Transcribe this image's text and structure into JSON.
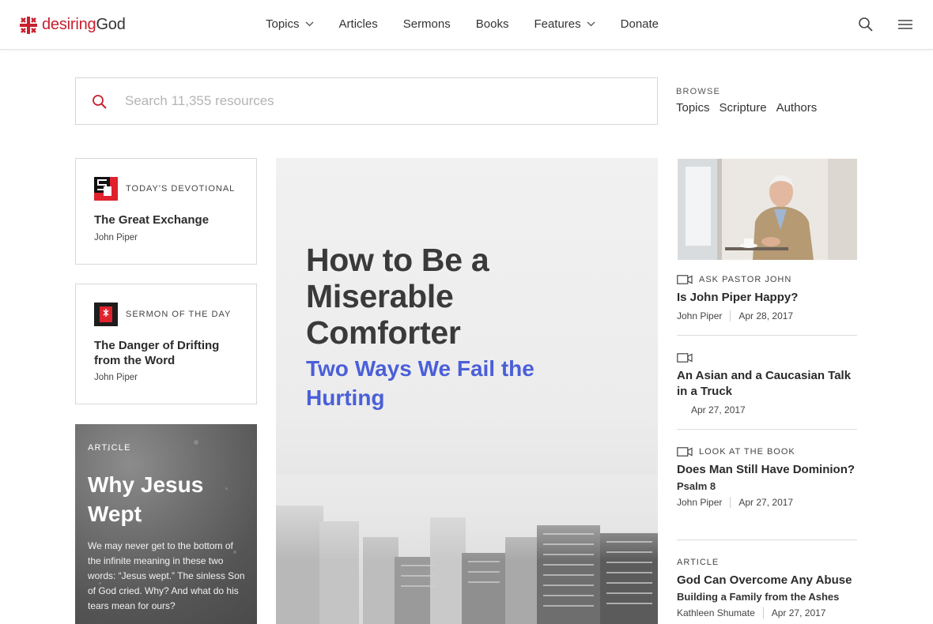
{
  "header": {
    "logo_prefix": "desiring",
    "logo_suffix": "God",
    "nav": [
      {
        "label": "Topics",
        "dropdown": true
      },
      {
        "label": "Articles",
        "dropdown": false
      },
      {
        "label": "Sermons",
        "dropdown": false
      },
      {
        "label": "Books",
        "dropdown": false
      },
      {
        "label": "Features",
        "dropdown": true
      },
      {
        "label": "Donate",
        "dropdown": false
      }
    ],
    "icons": [
      "search-icon",
      "hamburger-menu-icon"
    ]
  },
  "search": {
    "placeholder": "Search 11,355 resources"
  },
  "browse": {
    "label": "BROWSE",
    "links": [
      "Topics",
      "Scripture",
      "Authors"
    ]
  },
  "devotional": {
    "type": "TODAY'S DEVOTIONAL",
    "title": "The Great Exchange",
    "author": "John Piper"
  },
  "sermon": {
    "type": "SERMON OF THE DAY",
    "title": "The Danger of Drifting from the Word",
    "author": "John Piper"
  },
  "article_card": {
    "type": "ARTICLE",
    "title": "Why Jesus Wept",
    "excerpt": "We may never get to the bottom of the infinite meaning in these two words: “Jesus wept.” The sinless Son of God cried. Why? And what do his tears mean for ours?"
  },
  "hero": {
    "title": "How to Be a Miserable Comforter",
    "subtitle": "Two Ways We Fail the Hurting"
  },
  "right_items": [
    {
      "type": "ASK PASTOR JOHN",
      "video": true,
      "title": "Is John Piper Happy?",
      "subtitle": "",
      "author": "John Piper",
      "date": "Apr 28, 2017"
    },
    {
      "type": "",
      "video": true,
      "title": "An Asian and a Caucasian Talk in a Truck",
      "subtitle": "",
      "author": "",
      "date": "Apr 27, 2017"
    },
    {
      "type": "LOOK AT THE BOOK",
      "video": true,
      "title": "Does Man Still Have Dominion?",
      "subtitle": "Psalm 8",
      "author": "John Piper",
      "date": "Apr 27, 2017"
    },
    {
      "type": "ARTICLE",
      "video": false,
      "title": "God Can Overcome Any Abuse",
      "subtitle": "Building a Family from the Ashes",
      "author": "Kathleen Shumate",
      "date": "Apr 27, 2017"
    }
  ],
  "colors": {
    "brand_red": "#c8202f",
    "hero_subtitle": "#4a5fd8"
  }
}
